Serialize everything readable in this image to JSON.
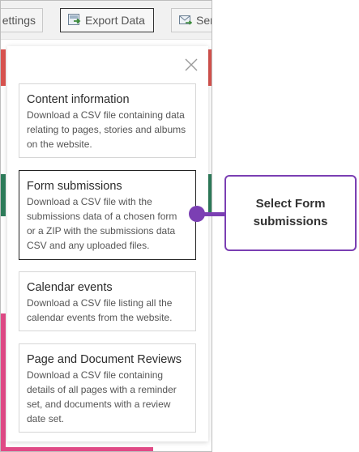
{
  "toolbar": {
    "settings_label": "ettings",
    "export_label": "Export Data",
    "send_label": "Sen"
  },
  "popup": {
    "options": [
      {
        "title": "Content information",
        "description": "Download a CSV file containing data relating to pages, stories and albums on the website."
      },
      {
        "title": "Form submissions",
        "description": "Download a CSV file with the submissions data of a chosen form or a ZIP with the submissions data CSV and any uploaded files."
      },
      {
        "title": "Calendar events",
        "description": "Download a CSV file listing all the calendar events from the website."
      },
      {
        "title": "Page and Document Reviews",
        "description": "Download a CSV file containing details of all pages with a reminder set, and documents with a review date set."
      }
    ],
    "selected_index": 1
  },
  "callout": {
    "text": "Select Form submissions"
  },
  "colors": {
    "accent": "#7b3fb3",
    "red": "#d9534f",
    "green": "#2e7d5b",
    "pink": "#e04a86"
  }
}
